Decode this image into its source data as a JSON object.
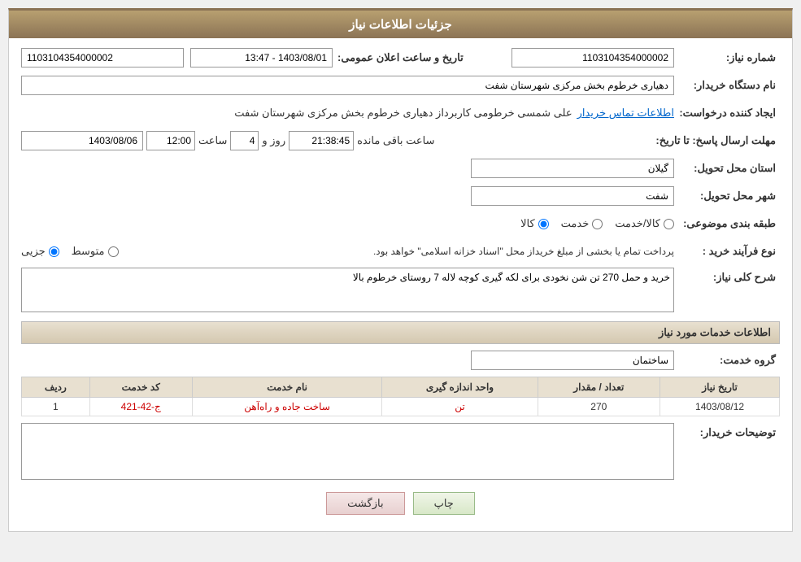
{
  "header": {
    "title": "جزئیات اطلاعات نیاز"
  },
  "fields": {
    "need_number_label": "شماره نیاز:",
    "need_number_value": "1103104354000002",
    "announce_date_label": "تاریخ و ساعت اعلان عمومی:",
    "announce_date_value": "1403/08/01 - 13:47",
    "buyer_org_label": "نام دستگاه خریدار:",
    "buyer_org_value": "دهیاری خرطوم بخش مرکزی شهرستان شفت",
    "creator_label": "ایجاد کننده درخواست:",
    "creator_value": "علی شمسی خرطومی کاربرداز دهیاری خرطوم بخش مرکزی شهرستان شفت",
    "contact_link": "اطلاعات تماس خریدار",
    "reply_deadline_label": "مهلت ارسال پاسخ: تا تاریخ:",
    "reply_date": "1403/08/06",
    "reply_time_label": "ساعت",
    "reply_time": "12:00",
    "reply_days_label": "روز و",
    "reply_days": "4",
    "reply_remaining": "21:38:45",
    "reply_remaining_label": "ساعت باقی مانده",
    "province_label": "استان محل تحویل:",
    "province_value": "گیلان",
    "city_label": "شهر محل تحویل:",
    "city_value": "شفت",
    "category_label": "طبقه بندی موضوعی:",
    "category_goods": "کالا",
    "category_service": "خدمت",
    "category_goods_service": "کالا/خدمت",
    "purchase_type_label": "نوع فرآیند خرید :",
    "purchase_type_partial": "جزیی",
    "purchase_type_medium": "متوسط",
    "purchase_note": "پرداخت تمام یا بخشی از مبلغ خریداز محل \"اسناد خزانه اسلامی\" خواهد بود.",
    "description_label": "شرح کلی نیاز:",
    "description_value": "خرید و حمل 270 تن شن نخودی برای لکه گیری کوچه لاله 7 روستای خرطوم بالا",
    "services_section_label": "اطلاعات خدمات مورد نیاز",
    "service_group_label": "گروه خدمت:",
    "service_group_value": "ساختمان",
    "table": {
      "col_row": "ردیف",
      "col_code": "کد خدمت",
      "col_name": "نام خدمت",
      "col_unit": "واحد اندازه گیری",
      "col_qty": "تعداد / مقدار",
      "col_date": "تاریخ نیاز",
      "rows": [
        {
          "row": "1",
          "code": "ج-42-421",
          "name": "ساخت جاده و راه‌آهن",
          "unit": "تن",
          "qty": "270",
          "date": "1403/08/12"
        }
      ]
    },
    "buyer_notes_label": "توضیحات خریدار:",
    "buyer_notes_value": ""
  },
  "buttons": {
    "back_label": "بازگشت",
    "print_label": "چاپ"
  }
}
